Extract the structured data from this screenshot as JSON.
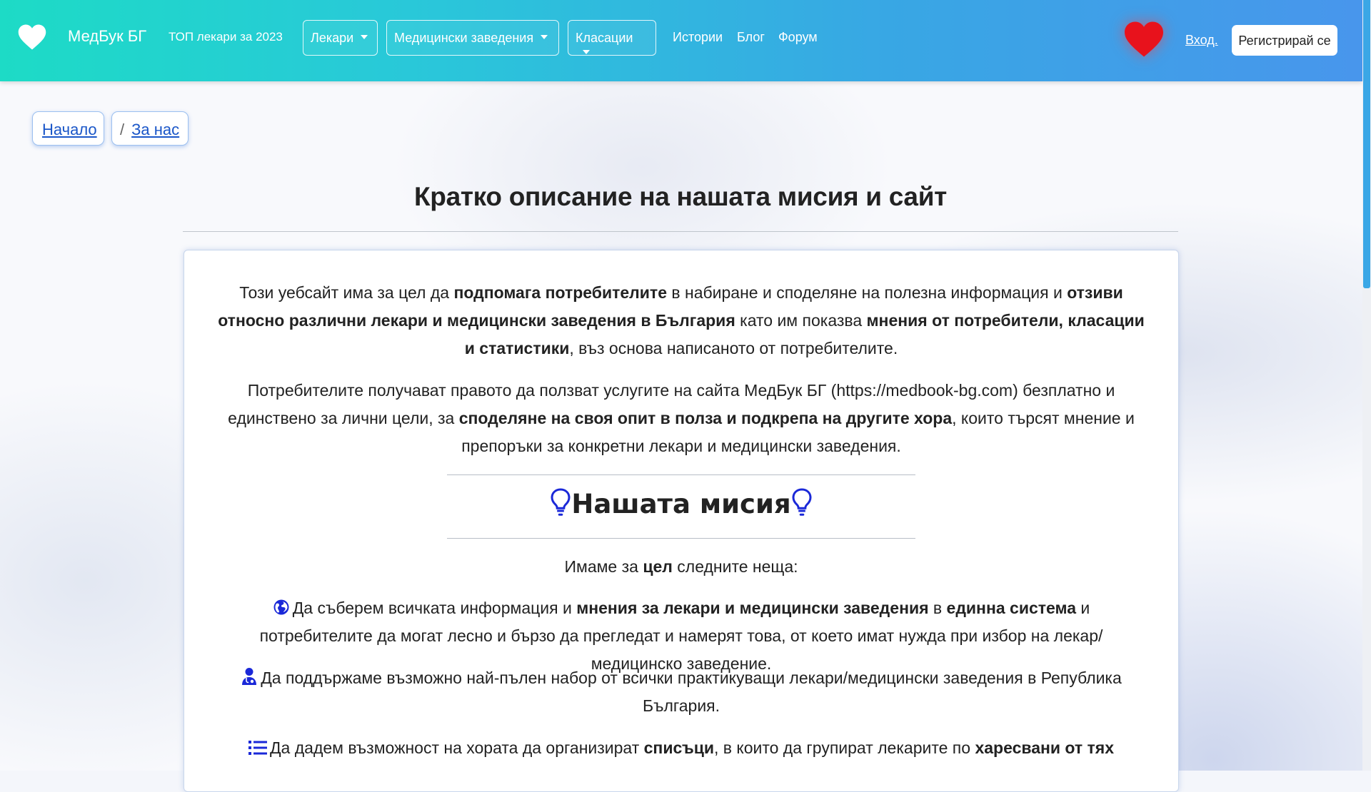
{
  "nav": {
    "brand": "МедБук БГ",
    "top_doctors": "ТОП лекари за 2023",
    "doctors": "Лекари",
    "facilities": "Медицински заведения",
    "rankings": "Класации",
    "stories": "Истории",
    "blog": "Блог",
    "forum": "Форум",
    "login": "Вход.",
    "register": "Регистрирай се"
  },
  "breadcrumb": {
    "home": "Начало",
    "separator": "/",
    "about": "За нас"
  },
  "page_title": "Кратко описание на нашата мисия и сайт",
  "intro": {
    "p1": [
      "Този уебсайт има за цел да ",
      "подпомага потребителите",
      " в набиране и споделяне на полезна информация и ",
      "отзиви относно различни лекари и медицински заведения в България",
      " като им показва ",
      "мнения от потребители, класации и статистики",
      ", въз основа написаното от потребителите."
    ],
    "p2": [
      "Потребителите получават правото да ползват услугите на сайта МедБук БГ (https://medbook-bg.com) безплатно и единствено за лични цели, за ",
      "споделяне на своя опит в полза и подкрепа на другите хора",
      ", които търсят мнение и препоръки за конкретни лекари и медицински заведения."
    ]
  },
  "mission": {
    "title": "Нашата мисия",
    "lead": [
      "Имаме за ",
      "цел",
      " следните неща:"
    ],
    "goal1": [
      "Да съберем всичката информация и ",
      "мнения за лекари и медицински заведения",
      " в ",
      "единна система",
      " и потребителите да могат лесно и бързо да прегледат и намерят това, от което имат нужда при избор на лекар/медицинско заведение."
    ],
    "goal2": "Да поддържаме възможно най-пълен набор от всички практикуващи лекари/медицински заведения в Република България.",
    "goal3": [
      "Да дадем възможност на хората да организират ",
      "списъци",
      ", в които да групират лекарите по ",
      "харесвани от тях"
    ]
  },
  "icons": {
    "brand": "heart-icon",
    "favorite": "heart-icon",
    "mission": "lightbulb-icon",
    "goal1": "globe-icon",
    "goal2": "doctor-icon",
    "goal3": "list-icon"
  },
  "colors": {
    "nav_gradient_start": "#1ddbc6",
    "nav_gradient_end": "#4896ec",
    "favorite_heart": "#e8121c",
    "link": "#1a56c8",
    "icon_blue": "#1a28d8"
  }
}
